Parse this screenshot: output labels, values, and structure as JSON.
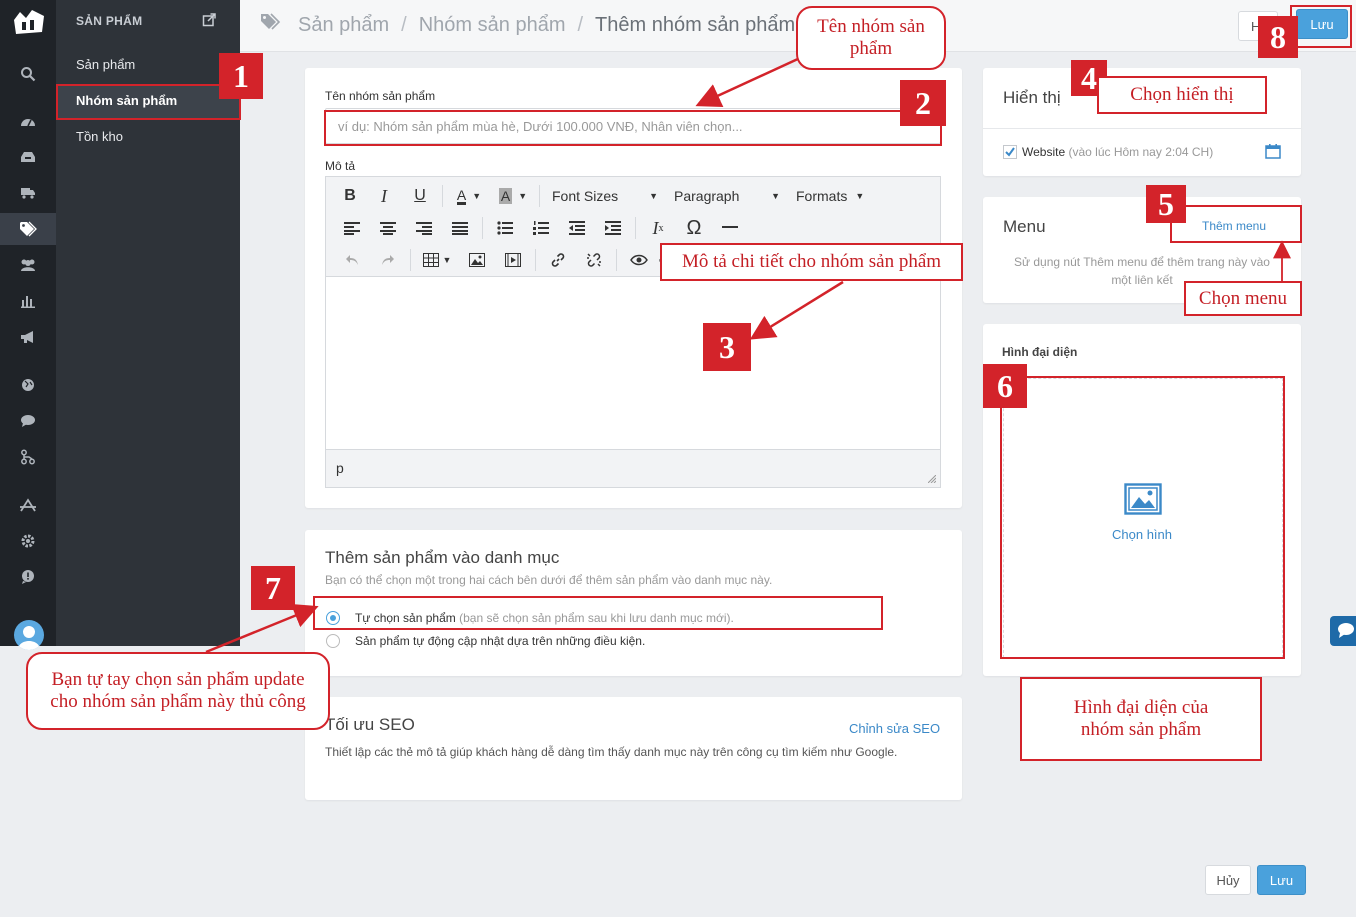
{
  "sidebar": {
    "section_title": "SẢN PHẨM",
    "items": [
      {
        "label": "Sản phẩm"
      },
      {
        "label": "Nhóm sản phẩm"
      },
      {
        "label": "Tồn kho"
      }
    ]
  },
  "header": {
    "breadcrumb": [
      "Sản phẩm",
      "Nhóm sản phẩm",
      "Thêm nhóm sản phẩm"
    ],
    "cancel_label": "H",
    "save_label": "Lưu"
  },
  "form": {
    "name_label": "Tên nhóm sản phẩm",
    "name_placeholder": "ví dụ: Nhóm sản phẩm mùa hè, Dưới 100.000 VNĐ, Nhân viên chọn...",
    "desc_label": "Mô tả",
    "toolbar": {
      "font_sizes": "Font Sizes",
      "paragraph": "Paragraph",
      "formats": "Formats"
    },
    "editor_status": "p"
  },
  "collection": {
    "title": "Thêm sản phẩm vào danh mục",
    "subtitle": "Bạn có thể chọn một trong hai cách bên dưới để thêm sản phẩm vào danh mục này.",
    "option_manual": "Tự chọn sản phẩm",
    "option_manual_hint": "(bạn sẽ chọn sản phẩm sau khi lưu danh mục mới).",
    "option_auto": "Sản phẩm tự động cập nhật dựa trên những điều kiện."
  },
  "seo": {
    "title": "Tối ưu SEO",
    "edit_link": "Chỉnh sửa SEO",
    "description": "Thiết lập các thẻ mô tả giúp khách hàng dễ dàng tìm thấy danh mục này trên công cụ tìm kiếm như Google."
  },
  "visibility": {
    "title": "Hiển thị",
    "channel": "Website",
    "channel_time": "(vào lúc Hôm nay 2:04 CH)"
  },
  "menu": {
    "title": "Menu",
    "add_link": "Thêm menu",
    "hint": "Sử dụng nút Thêm menu để thêm trang này vào một liên kết"
  },
  "image": {
    "title": "Hình đại diện",
    "choose_label": "Chọn hình"
  },
  "footer": {
    "cancel_label": "Hủy",
    "save_label": "Lưu"
  },
  "annotations": {
    "n1": "1",
    "n2": "2",
    "n3": "3",
    "n4": "4",
    "n5": "5",
    "n6": "6",
    "n7": "7",
    "n8": "8",
    "name_note": "Tên nhóm sản phẩm",
    "desc_note": "Mô tả chi tiết cho nhóm sản phẩm",
    "visibility_note": "Chọn hiển thị",
    "menu_note": "Chọn menu",
    "image_note": "Hình đại diện của nhóm sản phẩm",
    "manual_note": "Bạn tự tay chọn sản phẩm update cho nhóm sản phẩm này thủ công"
  },
  "colors": {
    "accent": "#4aa1dc",
    "annotation_red": "#d3232a",
    "sidebar_dark": "#1f2328"
  }
}
